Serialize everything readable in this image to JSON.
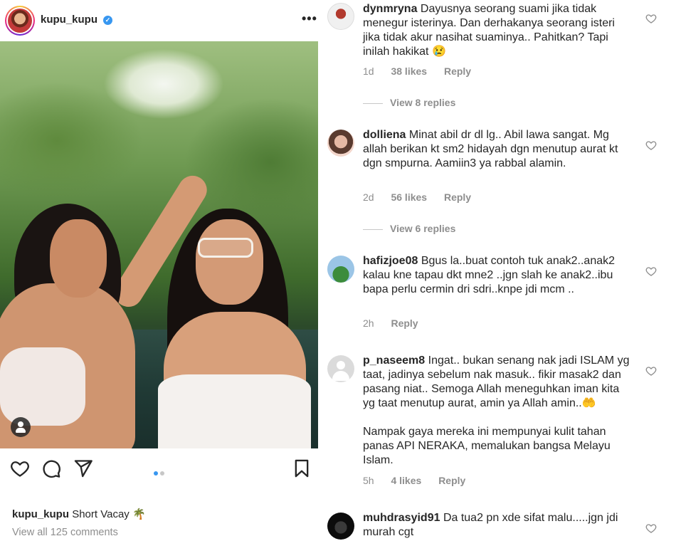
{
  "post": {
    "username": "kupu_kupu",
    "verified_glyph": "✓",
    "more_label": "•••",
    "caption_user": "kupu_kupu",
    "caption_text": "Short Vacay 🌴",
    "view_all_comments": "View all 125 comments",
    "carousel": {
      "count": 2,
      "active_index": 0
    },
    "icons": [
      "heart-icon",
      "comment-icon",
      "share-icon",
      "bookmark-icon",
      "user-tag-icon"
    ]
  },
  "comments": [
    {
      "username": "dynmryna",
      "text": "Dayusnya seorang suami jika tidak menegur isterinya. Dan derhakanya seorang isteri jika tidak akur nasihat suaminya.. Pahitkan? Tapi inilah hakikat 😢",
      "time": "1d",
      "likes": "38 likes",
      "reply": "Reply",
      "view_replies": "View 8 replies"
    },
    {
      "username": "dolliena",
      "text": "Minat abil dr dl lg.. Abil lawa sangat. Mg allah berikan kt sm2 hidayah dgn menutup aurat kt dgn smpurna. Aamiin3 ya rabbal alamin.",
      "time": "2d",
      "likes": "56 likes",
      "reply": "Reply",
      "view_replies": "View 6 replies"
    },
    {
      "username": "hafizjoe08",
      "text": "Bgus la..buat contoh tuk anak2..anak2 kalau kne tapau dkt mne2 ..jgn slah ke anak2..ibu bapa perlu cermin dri sdri..knpe jdi mcm ..",
      "time": "2h",
      "likes": "",
      "reply": "Reply"
    },
    {
      "username": "p_naseem8",
      "text": "Ingat.. bukan senang nak jadi ISLAM yg taat, jadinya sebelum nak masuk.. fikir masak2 dan pasang niat.. Semoga Allah meneguhkan iman kita yg taat menutup aurat, amin ya Allah amin..🤲",
      "text2": "Nampak gaya mereka ini mempunyai kulit tahan panas API NERAKA, memalukan bangsa Melayu Islam.",
      "time": "5h",
      "likes": "4 likes",
      "reply": "Reply"
    },
    {
      "username": "muhdrasyid91",
      "text": "Da tua2 pn xde sifat malu.....jgn jdi murah cgt"
    }
  ]
}
